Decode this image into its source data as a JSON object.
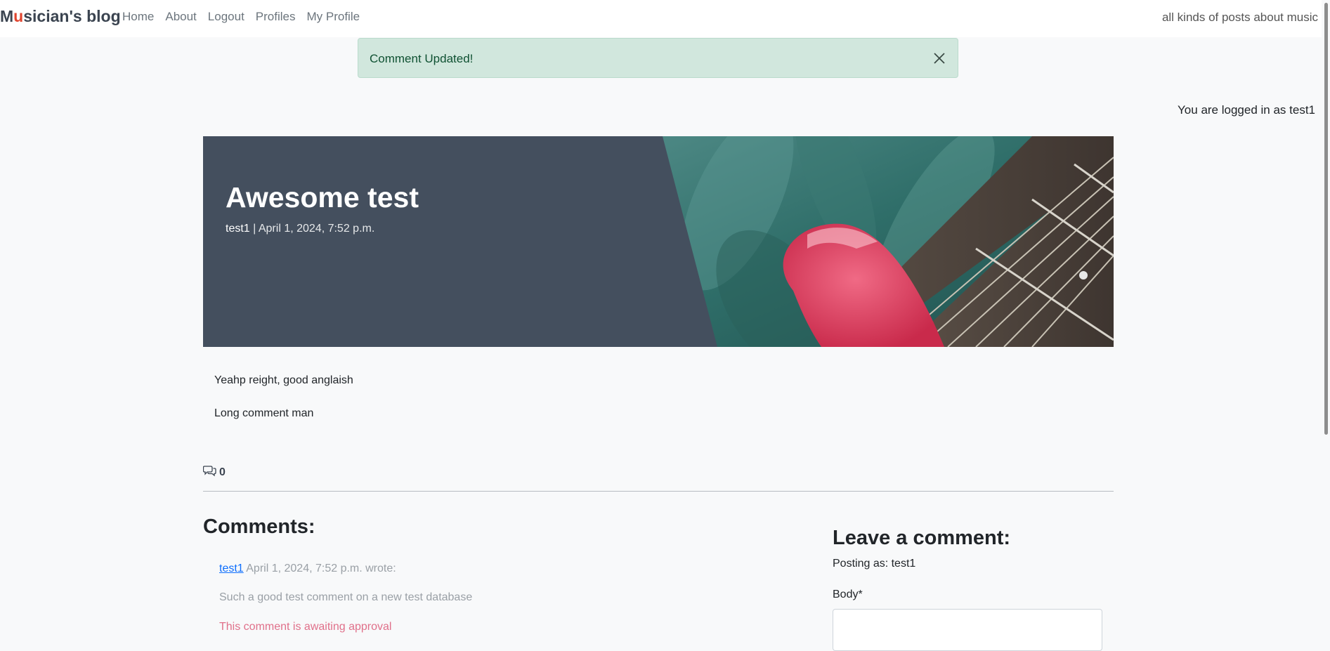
{
  "navbar": {
    "brand_first": "M",
    "brand_accent": "u",
    "brand_rest": "sician's blog",
    "links": [
      "Home",
      "About",
      "Logout",
      "Profiles",
      "My Profile"
    ],
    "tagline": "all kinds of posts about music"
  },
  "alert": {
    "message": "Comment Updated!",
    "close_icon": "close-icon"
  },
  "login_status": "You are logged in as test1",
  "post": {
    "title": "Awesome test",
    "author": "test1",
    "separator": " | ",
    "date": "April 1, 2024, 7:52 p.m.",
    "paragraphs": [
      "Yeahp reight, good anglaish",
      "Long comment man"
    ],
    "comment_count": "0",
    "comment_icon": "comments-icon"
  },
  "comments": {
    "heading": "Comments:",
    "items": [
      {
        "author": "test1",
        "date_wrote": " April 1, 2024, 7:52 p.m. wrote:",
        "body": "Such a good test comment on a new test database",
        "status": "This comment is awaiting approval"
      }
    ]
  },
  "comment_form": {
    "heading": "Leave a comment:",
    "posting_as": "Posting as: test1",
    "body_label": "Body*",
    "body_value": ""
  },
  "colors": {
    "brand_accent": "#e0442e",
    "alert_bg": "#d1e7dd",
    "alert_text": "#0f5132",
    "hero_panel": "#444f5e",
    "link": "#0d6efd",
    "awaiting": "#e0708a"
  }
}
